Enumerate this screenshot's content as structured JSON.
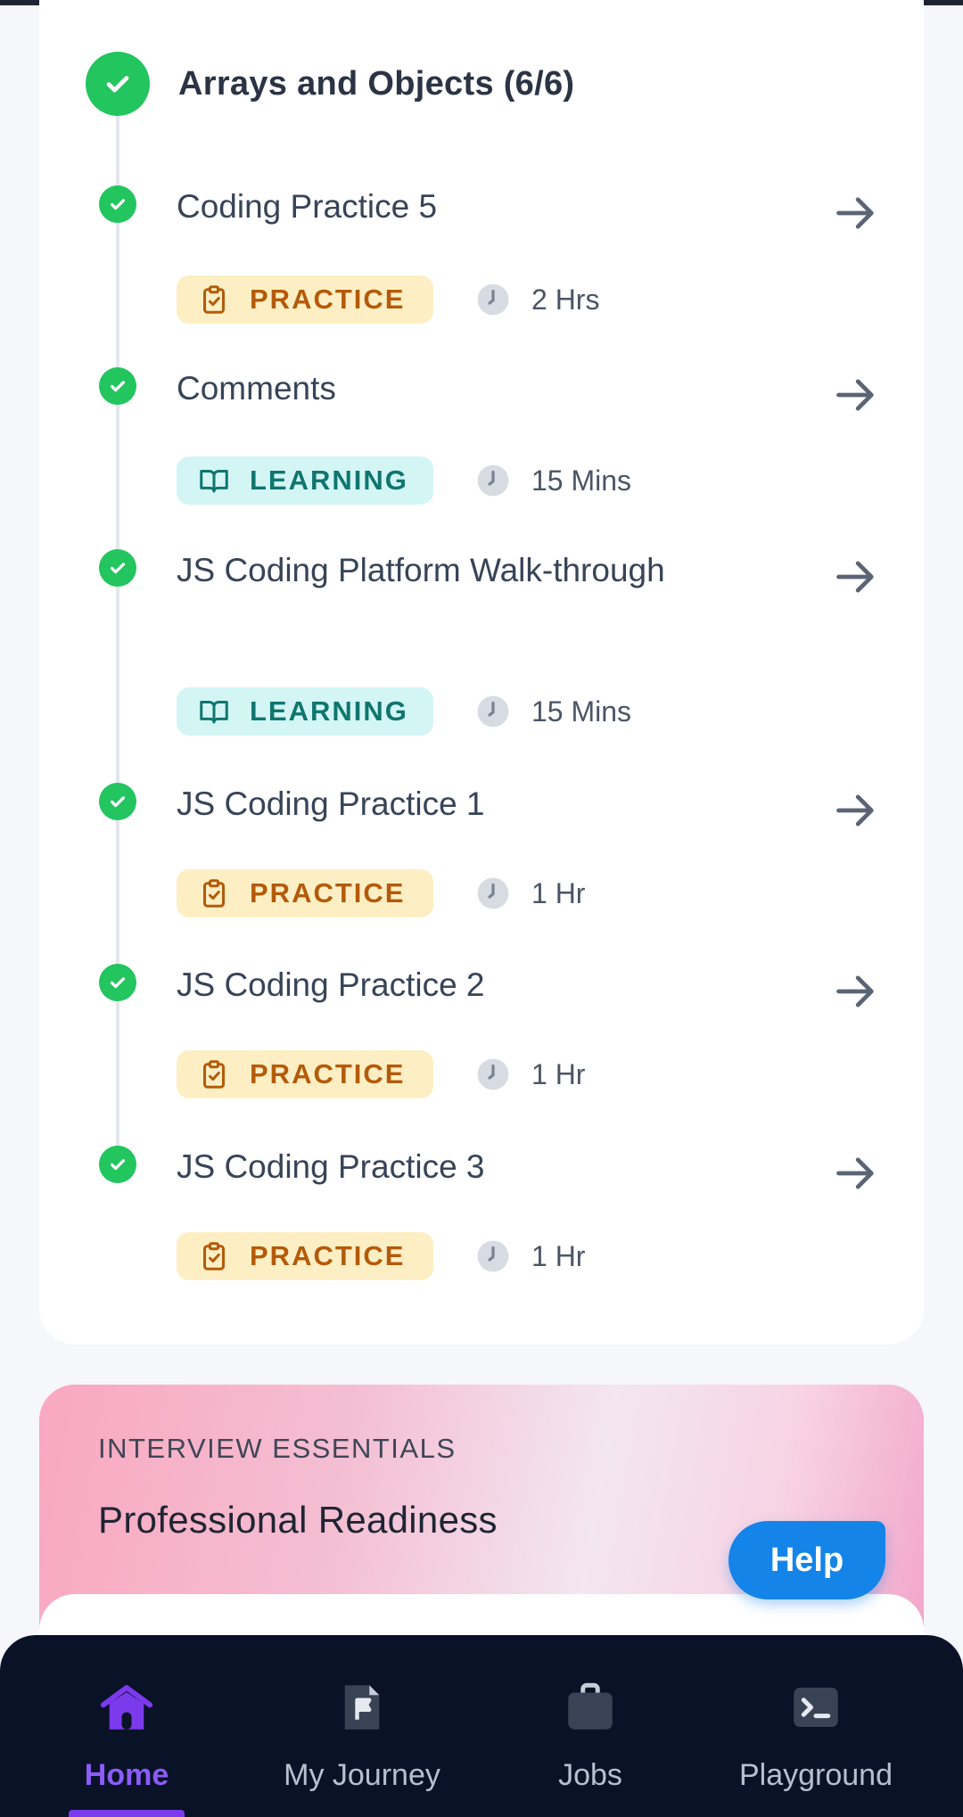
{
  "module": {
    "title": "Arrays and Objects (6/6)",
    "items": [
      {
        "title": "Coding Practice 5",
        "tag": "PRACTICE",
        "duration": "2 Hrs"
      },
      {
        "title": "Comments",
        "tag": "LEARNING",
        "duration": "15 Mins"
      },
      {
        "title": "JS Coding Platform Walk-through",
        "tag": "LEARNING",
        "duration": "15 Mins"
      },
      {
        "title": "JS Coding Practice 1",
        "tag": "PRACTICE",
        "duration": "1 Hr"
      },
      {
        "title": "JS Coding Practice 2",
        "tag": "PRACTICE",
        "duration": "1 Hr"
      },
      {
        "title": "JS Coding Practice 3",
        "tag": "PRACTICE",
        "duration": "1 Hr"
      }
    ]
  },
  "interview": {
    "label": "INTERVIEW ESSENTIALS",
    "title": "Professional Readiness"
  },
  "help_label": "Help",
  "nav": {
    "home": "Home",
    "journey": "My Journey",
    "jobs": "Jobs",
    "playground": "Playground"
  },
  "colors": {
    "success": "#22c55e",
    "practice_bg": "#fdefc3",
    "practice_text": "#b45a0a",
    "learning_bg": "#d3f6f5",
    "learning_text": "#0f766e",
    "accent": "#7c3aed",
    "help": "#1484e8"
  }
}
